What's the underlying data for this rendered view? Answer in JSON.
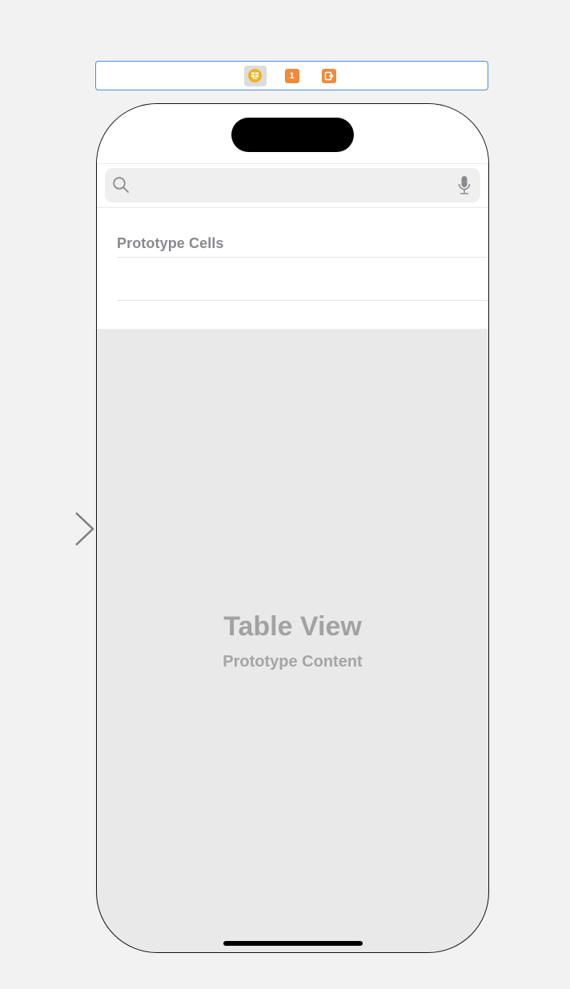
{
  "scene_dock": {
    "items": [
      {
        "icon": "view-controller-icon",
        "selected": true,
        "color": "#f0b21c"
      },
      {
        "icon": "first-responder-icon",
        "label": "1",
        "color": "#f08a3c"
      },
      {
        "icon": "exit-icon",
        "color": "#f08a3c"
      }
    ]
  },
  "table": {
    "section_title": "Prototype Cells",
    "placeholder_title": "Table View",
    "placeholder_subtitle": "Prototype Content"
  },
  "colors": {
    "selection_border": "#4a8be8",
    "canvas_background": "#f2f2f2",
    "table_background": "#e9e9e9"
  }
}
